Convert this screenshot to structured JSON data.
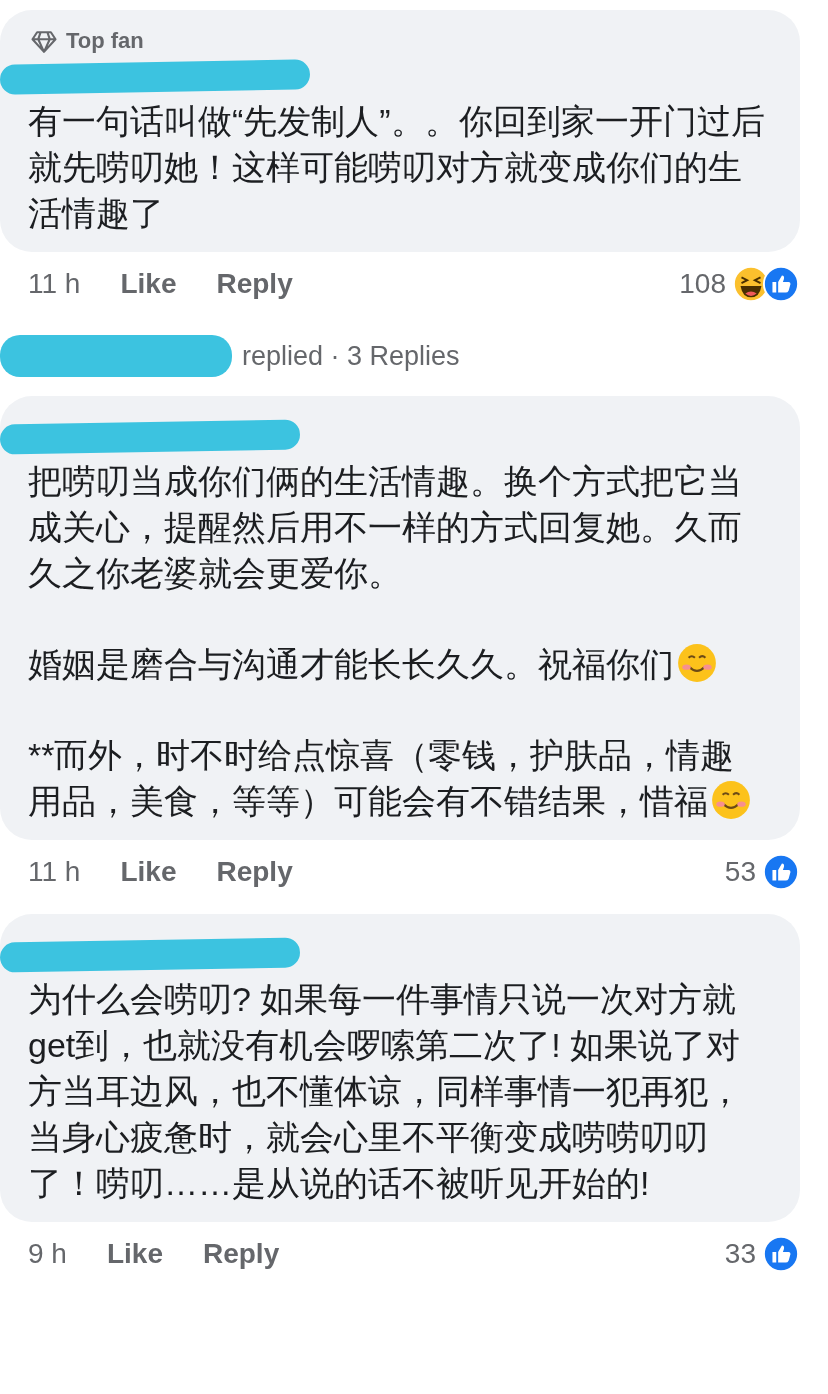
{
  "comments": [
    {
      "badge": "Top fan",
      "paragraphs": [
        {
          "text": "有一句话叫做“先发制人”。。你回到家一开门过后就先唠叨她！这样可能唠叨对方就变成你们的生活情趣了",
          "emoji_after": false
        }
      ],
      "time": "11 h",
      "like": "Like",
      "reply": "Reply",
      "count": "108",
      "reactions": [
        {
          "kind": "haha"
        },
        {
          "kind": "like"
        }
      ],
      "replies": {
        "label": "replied · 3 Replies"
      }
    },
    {
      "paragraphs": [
        {
          "text": "把唠叨当成你们俩的生活情趣。换个方式把它当成关心，提醒然后用不一样的方式回复她。久而久之你老婆就会更爱你。",
          "emoji_after": false
        },
        {
          "text": "婚姻是磨合与沟通才能长长久久。祝福你们",
          "emoji_after": true
        },
        {
          "text": "**而外，时不时给点惊喜（零钱，护肤品，情趣用品，美食，等等）可能会有不错结果，惜福",
          "emoji_after": true
        }
      ],
      "time": "11 h",
      "like": "Like",
      "reply": "Reply",
      "count": "53",
      "reactions": [
        {
          "kind": "like"
        }
      ]
    },
    {
      "paragraphs": [
        {
          "text": "为什么会唠叨? 如果每一件事情只说一次对方就get到，也就没有机会啰嗦第二次了! 如果说了对方当耳边风，也不懂体谅，同样事情一犯再犯，当身心疲惫时，就会心里不平衡变成唠唠叨叨了！唠叨……是从说的话不被听见开始的!",
          "emoji_after": false
        }
      ],
      "time": "9 h",
      "like": "Like",
      "reply": "Reply",
      "count": "33",
      "reactions": [
        {
          "kind": "like"
        }
      ]
    }
  ]
}
